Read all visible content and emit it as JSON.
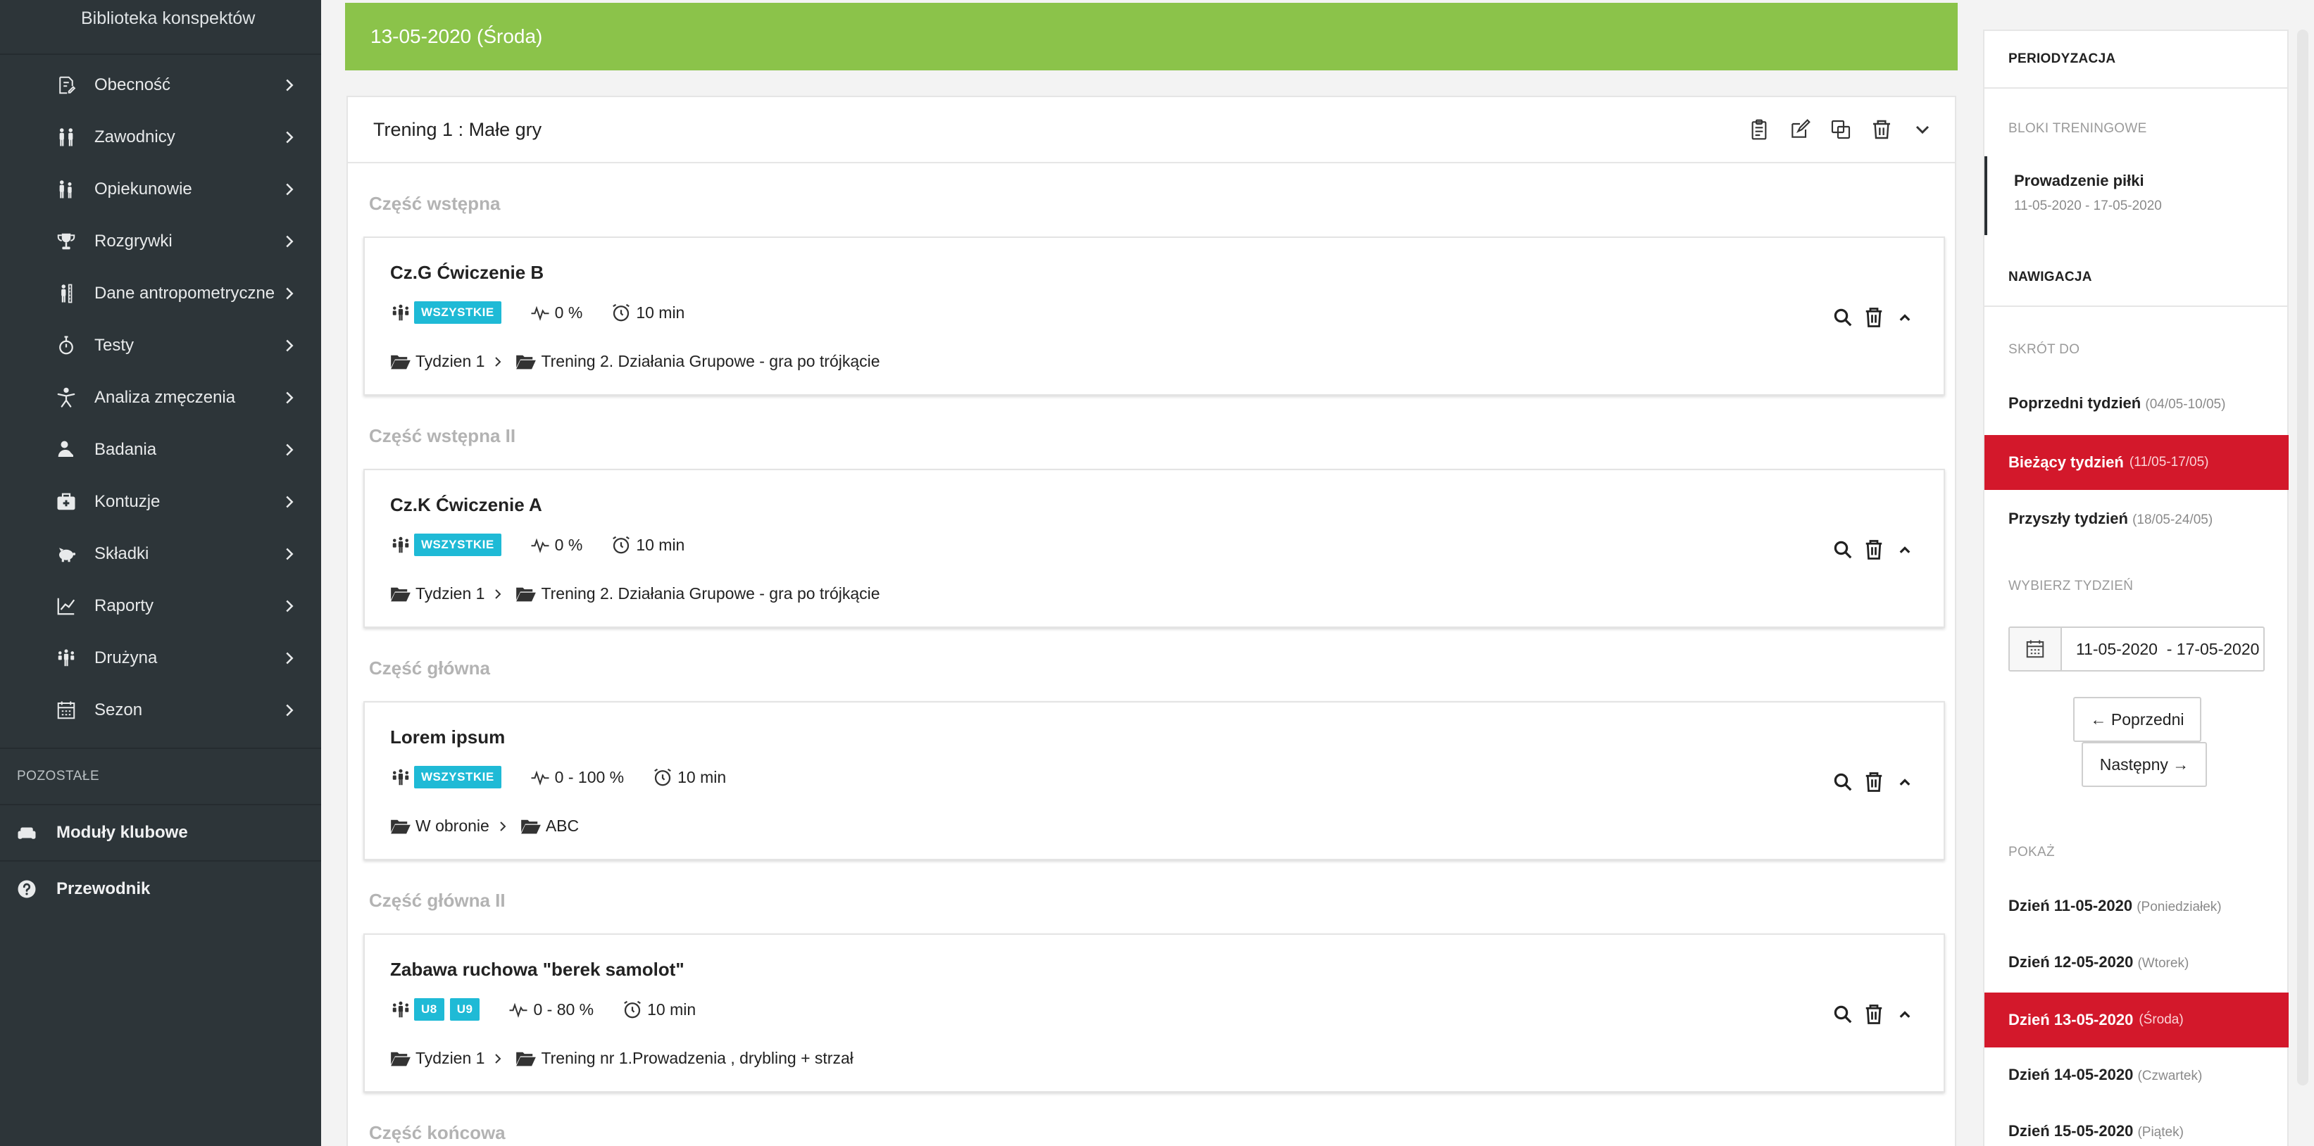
{
  "sidebar": {
    "brand": "Biblioteka konspektów",
    "items": [
      {
        "label": "Obecność",
        "icon": "attendance-icon"
      },
      {
        "label": "Zawodnicy",
        "icon": "players-icon"
      },
      {
        "label": "Opiekunowie",
        "icon": "guardians-icon"
      },
      {
        "label": "Rozgrywki",
        "icon": "trophy-icon"
      },
      {
        "label": "Dane antropometryczne",
        "icon": "anthropometry-icon"
      },
      {
        "label": "Testy",
        "icon": "stopwatch-icon"
      },
      {
        "label": "Analiza zmęczenia",
        "icon": "fatigue-icon"
      },
      {
        "label": "Badania",
        "icon": "research-icon"
      },
      {
        "label": "Kontuzje",
        "icon": "first-aid-icon"
      },
      {
        "label": "Składki",
        "icon": "piggy-bank-icon"
      },
      {
        "label": "Raporty",
        "icon": "chart-icon"
      },
      {
        "label": "Drużyna",
        "icon": "team-icon"
      },
      {
        "label": "Sezon",
        "icon": "calendar-icon"
      }
    ],
    "other_section": "POZOSTAŁE",
    "bottom": [
      {
        "label": "Moduły klubowe",
        "icon": "sofa-icon"
      },
      {
        "label": "Przewodnik",
        "icon": "help-icon"
      }
    ]
  },
  "main": {
    "day_banner": "13-05-2020 (Środa)",
    "training_title": "Trening 1 : Małe gry",
    "sections": [
      {
        "title": "Część wstępna",
        "exercise": {
          "title": "Cz.G Ćwiczenie B",
          "badges": [
            "WSZYSTKIE"
          ],
          "intensity": "0 %",
          "duration": "10 min",
          "path": [
            "Tydzien 1",
            "Trening 2. Działania Grupowe - gra po trójkącie"
          ]
        }
      },
      {
        "title": "Część wstępna II",
        "exercise": {
          "title": "Cz.K Ćwiczenie A",
          "badges": [
            "WSZYSTKIE"
          ],
          "intensity": "0 %",
          "duration": "10 min",
          "path": [
            "Tydzien 1",
            "Trening 2. Działania Grupowe - gra po trójkącie"
          ]
        }
      },
      {
        "title": "Część główna",
        "exercise": {
          "title": "Lorem ipsum",
          "badges": [
            "WSZYSTKIE"
          ],
          "intensity": "0 - 100 %",
          "duration": "10 min",
          "path": [
            "W obronie",
            "ABC"
          ]
        }
      },
      {
        "title": "Część główna II",
        "exercise": {
          "title": "Zabawa ruchowa \"berek samolot\"",
          "badges": [
            "U8",
            "U9"
          ],
          "intensity": "0 - 80 %",
          "duration": "10 min",
          "path": [
            "Tydzien 1",
            "Trening nr 1.Prowadzenia , drybling + strzał"
          ]
        }
      },
      {
        "title": "Część końcowa"
      }
    ]
  },
  "right": {
    "periodization": "PERIODYZACJA",
    "blocks_label": "BLOKI TRENINGOWE",
    "block": {
      "name": "Prowadzenie piłki",
      "range": "11-05-2020 - 17-05-2020"
    },
    "navigation": "NAWIGACJA",
    "shortcut_label": "SKRÓT DO",
    "prev_week": {
      "label": "Poprzedni tydzień",
      "range": "(04/05-10/05)"
    },
    "current_week": {
      "label": "Bieżący tydzień",
      "range": "(11/05-17/05)"
    },
    "next_week": {
      "label": "Przyszły tydzień",
      "range": "(18/05-24/05)"
    },
    "choose_week_label": "WYBIERZ TYDZIEŃ",
    "week_input_value": "11-05-2020  - 17-05-2020",
    "prev_button": "← Poprzedni",
    "next_button": "Następny →",
    "show_label": "POKAŻ",
    "days": [
      {
        "label": "Dzień 11-05-2020",
        "weekday": "(Poniedziałek)"
      },
      {
        "label": "Dzień 12-05-2020",
        "weekday": "(Wtorek)"
      },
      {
        "label": "Dzień 13-05-2020",
        "weekday": "(Środa)"
      },
      {
        "label": "Dzień 14-05-2020",
        "weekday": "(Czwartek)"
      },
      {
        "label": "Dzień 15-05-2020",
        "weekday": "(Piątek)"
      }
    ],
    "active_day_index": 2
  },
  "colors": {
    "sidebar_bg": "#2d3539",
    "banner_green": "#8bc34a",
    "badge_cyan": "#1fbad6",
    "active_red": "#d3182b"
  }
}
